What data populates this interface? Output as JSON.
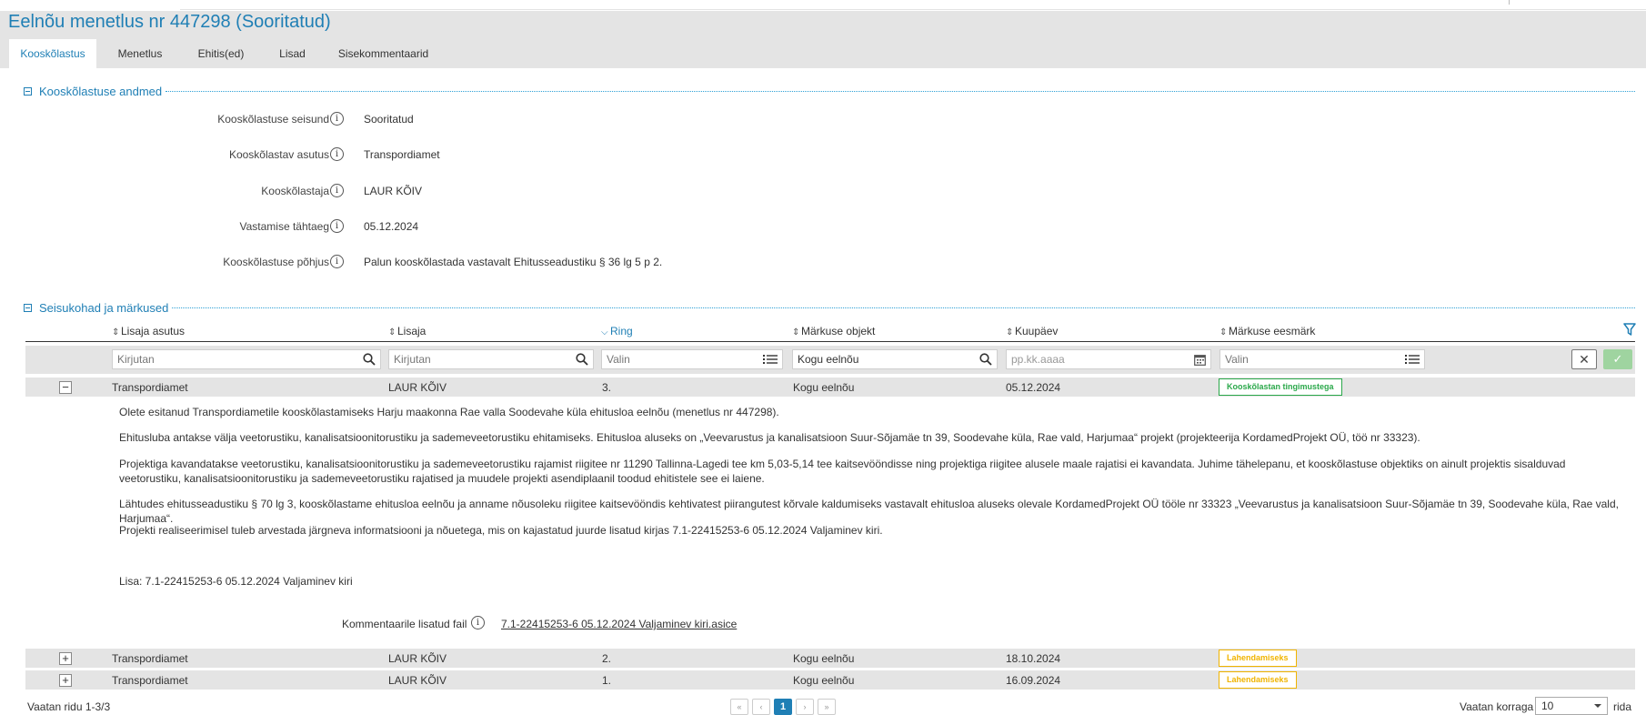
{
  "title": "Eelnõu menetlus nr 447298 (Sooritatud)",
  "tabs": [
    {
      "label": "Kooskõlastus",
      "active": true
    },
    {
      "label": "Menetlus"
    },
    {
      "label": "Ehitis(ed)"
    },
    {
      "label": "Lisad"
    },
    {
      "label": "Sisekommentaarid"
    }
  ],
  "section1": {
    "title": "Kooskõlastuse andmed",
    "fields": [
      {
        "label": "Kooskõlastuse seisund",
        "value": "Sooritatud"
      },
      {
        "label": "Kooskõlastav asutus",
        "value": "Transpordiamet"
      },
      {
        "label": "Kooskõlastaja",
        "value": "LAUR KÕIV"
      },
      {
        "label": "Vastamise tähtaeg",
        "value": "05.12.2024"
      },
      {
        "label": "Kooskõlastuse põhjus",
        "value": "Palun kooskõlastada vastavalt Ehitusseadustiku § 36 lg 5 p 2."
      }
    ]
  },
  "section2": {
    "title": "Seisukohad ja märkused",
    "columns": [
      "Lisaja asutus",
      "Lisaja",
      "Ring",
      "Märkuse objekt",
      "Kuupäev",
      "Märkuse eesmärk"
    ],
    "filters": {
      "asutus": "Kirjutan",
      "lisaja": "Kirjutan",
      "ring": "Valin",
      "objekt": "Kogu eelnõu",
      "kuupaev": "pp.kk.aaaa",
      "eesmark": "Valin"
    },
    "rows": [
      {
        "expand": "−",
        "asutus": "Transpordiamet",
        "lisaja": "LAUR KÕIV",
        "ring": "3.",
        "objekt": "Kogu eelnõu",
        "kuupaev": "05.12.2024",
        "eesmark": "Kooskõlastan tingimustega"
      },
      {
        "expand": "+",
        "asutus": "Transpordiamet",
        "lisaja": "LAUR KÕIV",
        "ring": "2.",
        "objekt": "Kogu eelnõu",
        "kuupaev": "18.10.2024",
        "eesmark": "Lahendamiseks"
      },
      {
        "expand": "+",
        "asutus": "Transpordiamet",
        "lisaja": "LAUR KÕIV",
        "ring": "1.",
        "objekt": "Kogu eelnõu",
        "kuupaev": "16.09.2024",
        "eesmark": "Lahendamiseks"
      }
    ],
    "detail": {
      "p1": "Olete esitanud Transpordiametile kooskõlastamiseks Harju maakonna Rae valla Soodevahe küla ehitusloa eelnõu (menetlus nr 447298).",
      "p2": "Ehitusluba antakse välja veetorustiku, kanalisatsioonitorustiku ja sademeveetorustiku ehitamiseks. Ehitusloa aluseks on „Veevarustus ja kanalisatsioon Suur-Sõjamäe tn 39, Soodevahe küla, Rae vald, Harjumaa“ projekt (projekteerija KordamedProjekt OÜ, töö nr 33323).",
      "p3": "Projektiga kavandatakse veetorustiku, kanalisatsioonitorustiku ja sademeveetorustiku rajamist riigitee nr 11290 Tallinna-Lagedi tee km 5,03-5,14 tee kaitsevööndisse ning projektiga riigitee alusele maale rajatisi ei kavandata. Juhime tähelepanu, et kooskõlastuse objektiks on ainult projektis sisalduvad veetorustiku, kanalisatsioonitorustiku ja sademeveetorustiku rajatised ja muudele projekti asendiplaanil toodud ehitistele see ei laiene.",
      "p4": "Lähtudes ehitusseadustiku § 70 lg 3, kooskõlastame ehitusloa eelnõu ja anname nõusoleku riigitee kaitsevööndis kehtivatest piirangutest kõrvale kaldumiseks vastavalt ehitusloa aluseks olevale KordamedProjekt OÜ tööle nr 33323 „Veevarustus ja kanalisatsioon Suur-Sõjamäe tn 39, Soodevahe küla, Rae vald, Harjumaa“.",
      "p5": "Projekti realiseerimisel tuleb arvestada järgneva informatsiooni ja nõuetega, mis on kajastatud juurde lisatud kirjas 7.1-22415253-6 05.12.2024 Valjaminev kiri.",
      "p6": "Lisa: 7.1-22415253-6 05.12.2024 Valjaminev kiri",
      "attach_label": "Kommentaarile lisatud fail",
      "attach_file": "7.1-22415253-6 05.12.2024 Valjaminev kiri.asice"
    }
  },
  "footer": {
    "rows_text": "Vaatan ridu 1-3/3",
    "pages": [
      "«",
      "‹",
      "1",
      "›",
      "»"
    ],
    "current_page": "1",
    "show_label": "Vaatan korraga",
    "page_size": "10",
    "rows_suffix": "rida"
  },
  "colors": {
    "accent": "#1f7fb5",
    "green": "#2aa84a",
    "yellow": "#f0b400"
  }
}
